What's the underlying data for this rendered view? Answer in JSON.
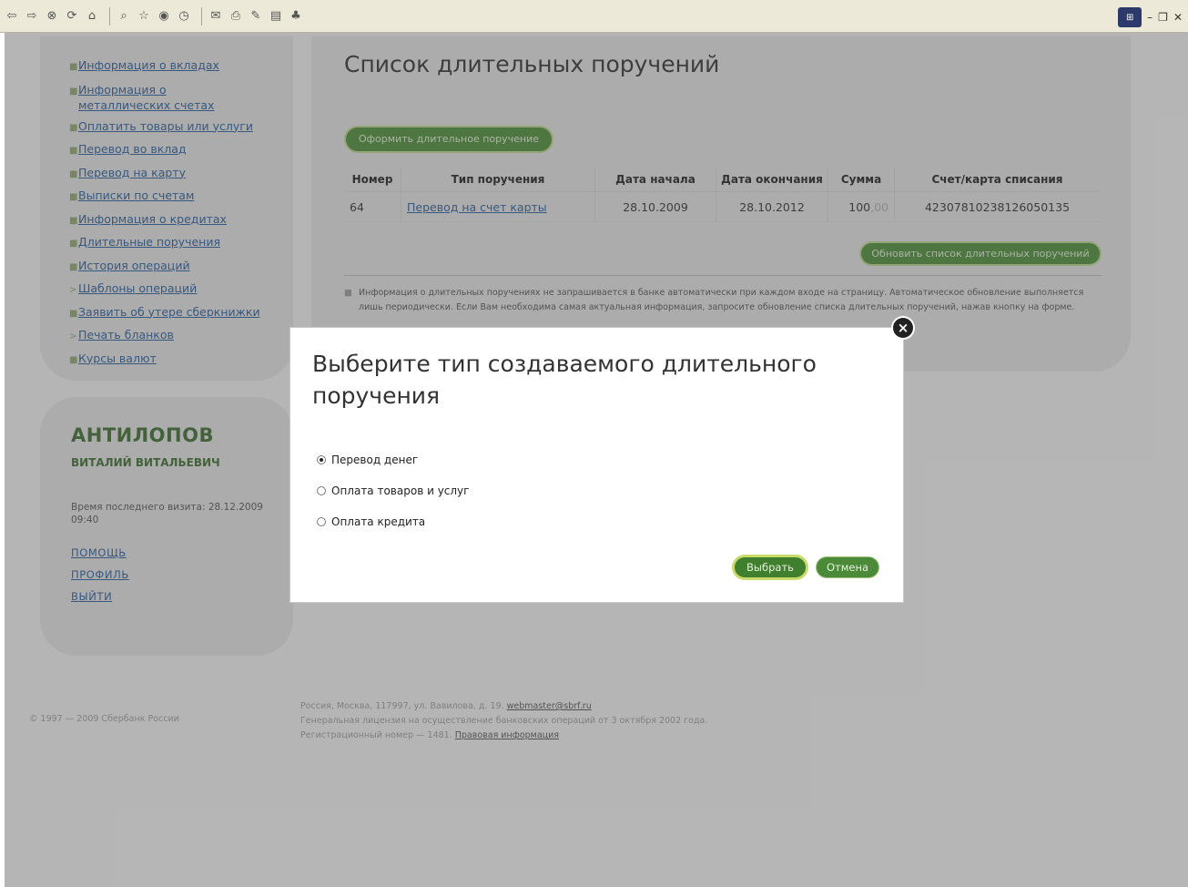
{
  "toolbar": {
    "icons": [
      "back-icon",
      "forward-icon",
      "stop-icon",
      "refresh-icon",
      "home-icon",
      "search-icon",
      "favorites-icon",
      "media-icon",
      "history-icon",
      "mail-icon",
      "print-icon",
      "edit-icon",
      "discuss-icon",
      "messenger-icon"
    ],
    "window_controls": [
      "minimize-icon",
      "restore-icon",
      "close-window-icon"
    ]
  },
  "nav": {
    "items": [
      {
        "bullet": "■",
        "label": "Информация о вкладах"
      },
      {
        "bullet": "■",
        "label": "Информация о металлических счетах"
      },
      {
        "bullet": "■",
        "label": "Оплатить товары или услуги"
      },
      {
        "bullet": "■",
        "label": "Перевод во вклад"
      },
      {
        "bullet": "■",
        "label": "Перевод на карту"
      },
      {
        "bullet": "■",
        "label": "Выписки по счетам"
      },
      {
        "bullet": "■",
        "label": "Информация о кредитах"
      },
      {
        "bullet": "■",
        "label": "Длительные поручения"
      },
      {
        "bullet": "■",
        "label": "История операций"
      },
      {
        "bullet": ">",
        "label": "Шаблоны операций"
      },
      {
        "bullet": "■",
        "label": "Заявить об утере сберкнижки"
      },
      {
        "bullet": ">",
        "label": "Печать бланков"
      },
      {
        "bullet": "■",
        "label": "Курсы валют"
      }
    ]
  },
  "user": {
    "last_name": "АНТИЛОПОВ",
    "first_name": "ВИТАЛИЙ ВИТАЛЬЕВИЧ",
    "last_visit": "Время последнего визита: 28.12.2009 09:40",
    "help": "ПОМОЩЬ",
    "profile": "ПРОФИЛЬ",
    "logout": "ВЫЙТИ"
  },
  "main": {
    "title": "Список длительных поручений",
    "create_button": "Оформить длительное поручение",
    "refresh_button": "Обновить список длительных поручений",
    "table": {
      "headers": [
        "Номер",
        "Тип поручения",
        "Дата начала",
        "Дата окончания",
        "Сумма",
        "Счет/карта списания"
      ],
      "rows": [
        {
          "number": "64",
          "type": "Перевод на счет карты",
          "start": "28.10.2009",
          "end": "28.10.2012",
          "amount_rub": "100",
          "amount_kop": ",00",
          "account": "42307810238126050135"
        }
      ]
    },
    "info": "Информация о длительных поручениях не запрашивается в банке автоматически при каждом входе на страницу. Автоматическое обновление выполняется лишь периодически. Если Вам необходима самая актуальная информация, запросите обновление списка длительных поручений, нажав кнопку на форме."
  },
  "footer": {
    "copyright": "© 1997 — 2009 Сбербанк России",
    "address_prefix": "Россия, Москва, 117997, ул. Вавилова, д. 19.",
    "email": "webmaster@sbrf.ru",
    "license": "Генеральная лицензия на осуществление банковских операций от 3 октября 2002 года.",
    "reg_prefix": "Регистрационный номер — 1481.",
    "legal_link": "Правовая информация"
  },
  "modal": {
    "title": "Выберите тип создаваемого длительного поручения",
    "options": [
      {
        "label": "Перевод денег",
        "selected": true
      },
      {
        "label": "Оплата товаров и услуг",
        "selected": false
      },
      {
        "label": "Оплата кредита",
        "selected": false
      }
    ],
    "select_button": "Выбрать",
    "cancel_button": "Отмена"
  },
  "colors": {
    "brand_green": "#4d8a3a",
    "link_blue": "#2b5c97",
    "panel_bg": "#dedede"
  }
}
